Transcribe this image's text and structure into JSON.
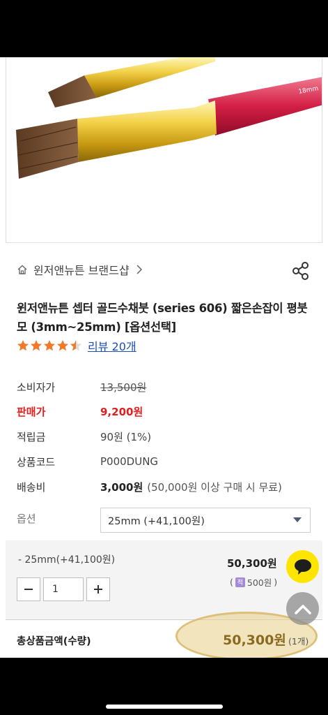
{
  "breadcrumb": {
    "brand_label": "윈저앤뉴튼 브랜드샵"
  },
  "product": {
    "title": "윈저앤뉴튼 셉터 골드수채붓 (series 606) 짧은손잡이 평붓모 (3mm~25mm) [옵션선택]",
    "rating_value": 4.5,
    "review_label": "리뷰 20개"
  },
  "info": {
    "consumer_price_label": "소비자가",
    "consumer_price": "13,500원",
    "sale_price_label": "판매가",
    "sale_price": "9,200원",
    "points_label": "적립금",
    "points": "90원 (1%)",
    "code_label": "상품코드",
    "code": "P000DUNG",
    "shipping_label": "배송비",
    "shipping_fee": "3,000원",
    "shipping_note": "(50,000원 이상 구매 시 무료)"
  },
  "option": {
    "label": "옵션",
    "selected": "25mm (+41,100원)"
  },
  "selected_item": {
    "name": "- 25mm(+41,100원)",
    "quantity": "1",
    "price": "50,300원",
    "point_badge": "적",
    "points": "500원"
  },
  "total": {
    "label": "총상품금액(수량)",
    "amount": "50,300원",
    "count": "(1개)"
  },
  "colors": {
    "accent_red": "#e01e1e",
    "link_blue": "#1a4fb8",
    "star": "#f07a2a",
    "kakao_yellow": "#fee500",
    "highlight": "#e8cd87"
  },
  "icons": [
    "home-icon",
    "chevron-right-icon",
    "share-icon",
    "star-icon",
    "minus-icon",
    "plus-icon",
    "kakao-chat-icon",
    "chevron-up-icon",
    "point-icon",
    "dropdown-caret-icon"
  ]
}
